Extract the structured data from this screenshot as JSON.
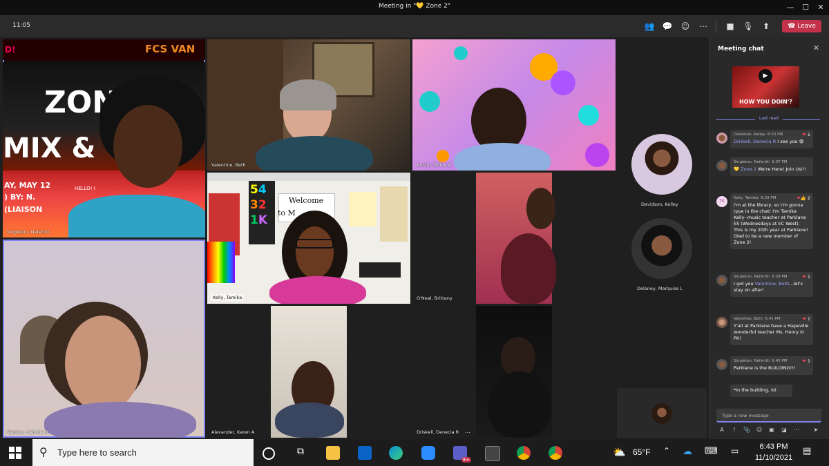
{
  "window": {
    "title": "Meeting in \"💛 Zone 2\""
  },
  "toolbar": {
    "clock": "11:05",
    "leave_label": "Leave"
  },
  "zone_slide": {
    "text_top": "FCS VAN",
    "text_left": "D!",
    "text_big1": "ZON",
    "text_big2": "MIX &",
    "text_date": "AY, MAY 12",
    "text_by": ") BY: N.",
    "text_liaison": "(LIAISON",
    "text_hello": "HELLO! I"
  },
  "classroom": {
    "numbers": [
      "5",
      "4",
      "3",
      "2",
      "1",
      "K"
    ],
    "welcome": "Welcome",
    "welcome_to": "to M"
  },
  "tiles": [
    {
      "name": "Singleton, Nefertiti"
    },
    {
      "name": "Valentine, Beth"
    },
    {
      "name": "Austin, Lillian A"
    },
    {
      "name": "Kelly, Tamika"
    },
    {
      "name": "O'Neal, Brittany"
    },
    {
      "name": "Mackey, Sabrina R"
    },
    {
      "name": "Alexander, Karen A"
    },
    {
      "name": "Driskell, Denecia R"
    }
  ],
  "side_participants": [
    {
      "name": "Davidson, Kelley"
    },
    {
      "name": "Delaney, Marquise L"
    }
  ],
  "chat": {
    "title": "Meeting chat",
    "gif_caption": "HOW YOU DOIN'?",
    "last_read": "Last read",
    "messages": [
      {
        "author": "Davidson, Kelley",
        "time": "6:33 PM",
        "reactions": "1",
        "mention": "Driskell, Denecia R",
        "text": " I see you 😄"
      },
      {
        "author": "Singleton, Nefertiti",
        "time": "6:37 PM",
        "reactions": "",
        "mention": "Zone 2",
        "text_pre": "💛 ",
        "text": " We're Here! Join Us!!!"
      },
      {
        "author": "Kelly, Tamika",
        "time": "6:39 PM",
        "reactions": "2",
        "initials": "TK",
        "text": "I'm at the library, so I'm gonna type in the chat! I'm Tamika Kelly--music teacher at Parklane ES (Wednesdays at EC West). This is my 20th year at Parklane! Glad to be a new member of Zone 2!"
      },
      {
        "author": "Singleton, Nefertiti",
        "time": "6:39 PM",
        "reactions": "1",
        "text_pre": "I got you ",
        "mention": "Valentine, Beth",
        "text": "...let's stay on after!"
      },
      {
        "author": "Valentine, Beth",
        "time": "6:41 PM",
        "reactions": "1",
        "text": "Y'all at Parklane have a Hapeville wonderful teacher Ms. Henry in PK!"
      },
      {
        "author": "Singleton, Nefertiti",
        "time": "6:43 PM",
        "reactions": "1",
        "text": "Parklane is the BUILDING!!!"
      }
    ],
    "followup": "*in the building, lol",
    "compose_placeholder": "Type a new message"
  },
  "taskbar": {
    "search_placeholder": "Type here to search",
    "teams_badge": "9+",
    "weather": "65°F",
    "time": "6:43 PM",
    "date": "11/10/2021"
  }
}
